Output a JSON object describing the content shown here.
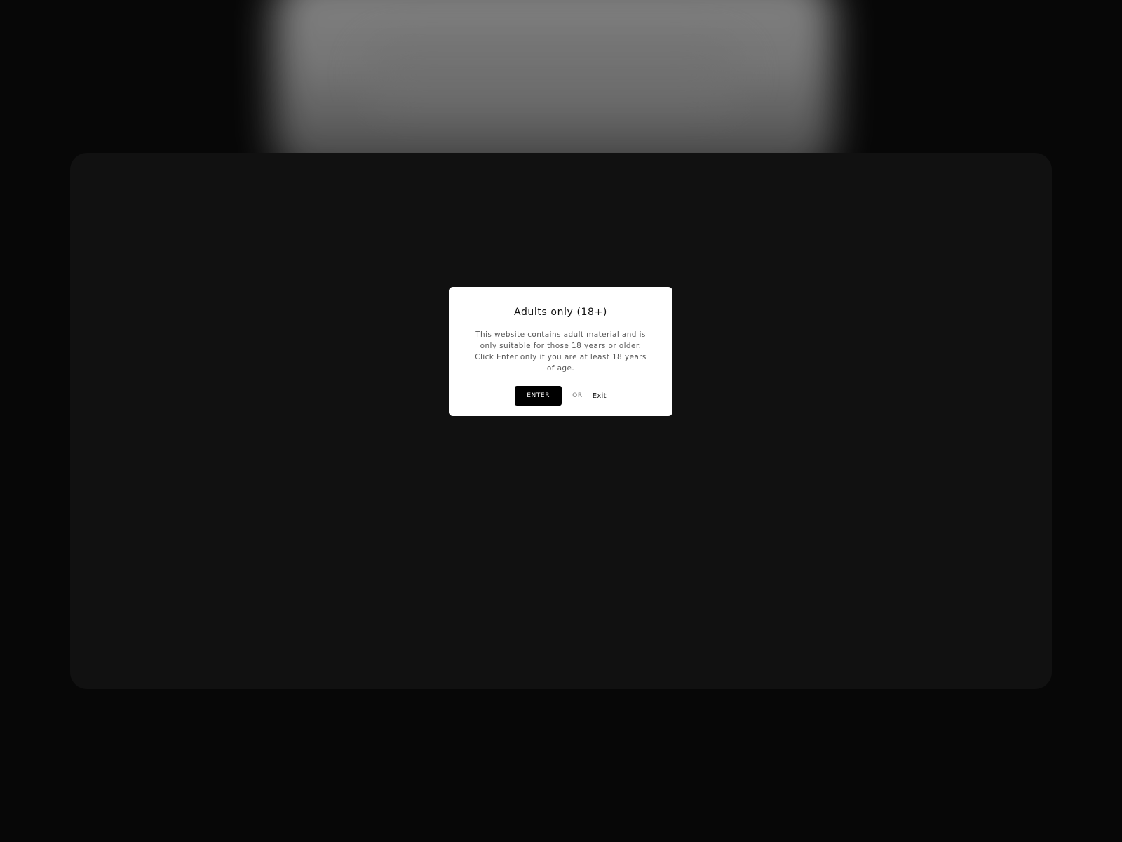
{
  "age_gate": {
    "title": "Adults only (18+)",
    "message": "This website contains adult material and is only suitable for those 18 years or older. Click Enter only if you are at least 18 years of age.",
    "enter_label": "ENTER",
    "or_label": "OR",
    "exit_label": "Exit"
  },
  "colors": {
    "page_background": "#070707",
    "content_panel": "#111111",
    "modal_background": "#ffffff",
    "enter_button": "#000000"
  }
}
